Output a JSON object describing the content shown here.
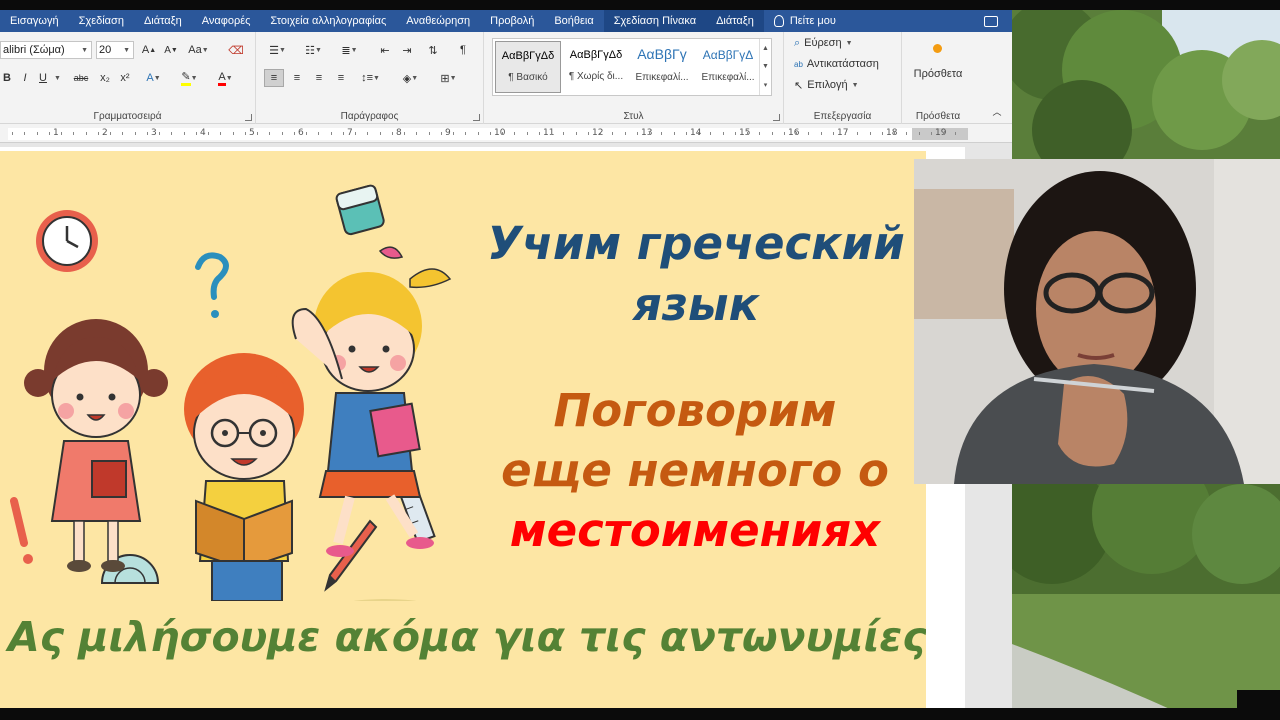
{
  "menu": {
    "tabs": [
      "Εισαγωγή",
      "Σχεδίαση",
      "Διάταξη",
      "Αναφορές",
      "Στοιχεία αλληλογραφίας",
      "Αναθεώρηση",
      "Προβολή",
      "Βοήθεια",
      "Σχεδίαση Πίνακα",
      "Διάταξη"
    ],
    "tell_me": "Πείτε μου"
  },
  "ribbon": {
    "font_name": "alibri (Σώμα)",
    "font_size": "20",
    "group_font": "Γραμματοσειρά",
    "group_paragraph": "Παράγραφος",
    "group_styles": "Στυλ",
    "group_editing": "Επεξεργασία",
    "group_addins": "Πρόσθετα",
    "styles": [
      {
        "sample": "ΑαΒβΓγΔδ",
        "name": "¶ Βασικό"
      },
      {
        "sample": "ΑαΒβΓγΔδ",
        "name": "¶ Χωρίς δι..."
      },
      {
        "sample": "ΑαΒβΓγ",
        "name": "Επικεφαλί..."
      },
      {
        "sample": "ΑαΒβΓγΔ",
        "name": "Επικεφαλί..."
      }
    ],
    "find": "Εύρεση",
    "replace": "Αντικατάσταση",
    "select": "Επιλογή",
    "addins": "Πρόσθετα",
    "bold": "B",
    "italic": "I",
    "underline": "U",
    "strike": "abc",
    "subscript": "x₂",
    "superscript": "x²",
    "case": "Aa"
  },
  "ruler": {
    "numbers": [
      "1",
      "2",
      "3",
      "4",
      "5",
      "6",
      "7",
      "8",
      "9",
      "10",
      "11",
      "12",
      "13",
      "14",
      "15",
      "16",
      "17",
      "18",
      "19"
    ]
  },
  "document": {
    "title_line1": "Учим греческий",
    "title_line2": "язык",
    "subtitle_line1": "Поговорим",
    "subtitle_line2": "еще немного о",
    "subtitle_line3": "местоимениях",
    "greek_line": "Ας μιλήσουμε ακόμα για τις αντωνυμίες"
  },
  "colors": {
    "ribbon_blue": "#2b579a",
    "banner_bg": "#fde6a4",
    "title_blue": "#1f4e79",
    "subtitle_orange": "#c55a11",
    "subtitle_red": "#ff0000",
    "greek_green": "#548235"
  },
  "icons": [
    "bulb-icon",
    "comment-icon",
    "search-icon",
    "replace-icon",
    "select-cursor-icon",
    "addin-icon",
    "clock-icon",
    "question-mark-icon",
    "eraser-icon",
    "exclamation-icon",
    "protractor-icon",
    "pencil-icon",
    "ruler-icon"
  ]
}
